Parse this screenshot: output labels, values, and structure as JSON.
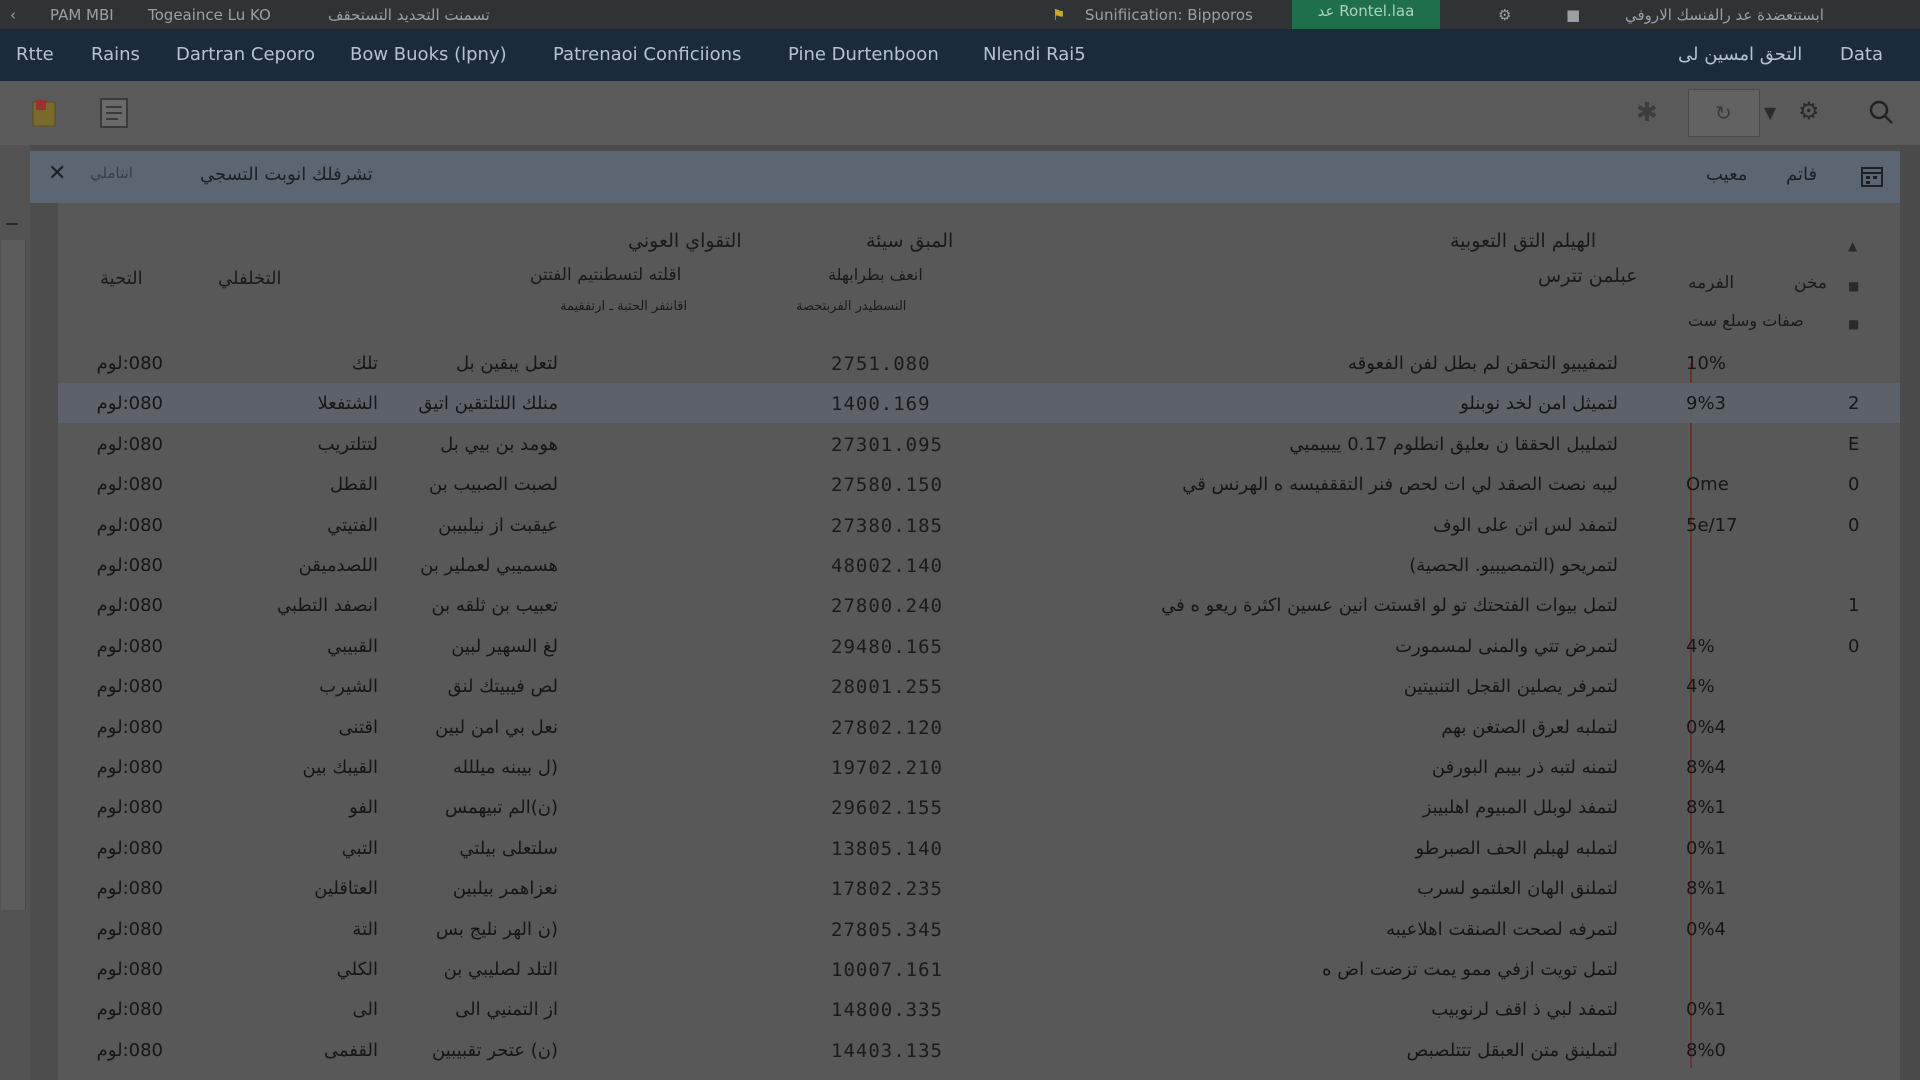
{
  "topbar": {
    "back_label": "PAM MBI",
    "tab1": "Togeaince Lu KO",
    "tab2": "تسمنت التحديد التستحقف",
    "notification": "Sunifiication: Bipporos",
    "active_button": "عد Rontel.laa",
    "right_text": "ابستتعضدة عد رالفنسك الاروفي"
  },
  "menu": {
    "items": [
      "Rtte",
      "Rains",
      "Dartran Ceporo",
      "Bow Buoks (lpny)",
      "Patrenaoi Conficiions",
      "Pine Durtenboon",
      "Nlendi Rai5"
    ],
    "right_item": "التحق امسين لى",
    "brand": "Data"
  },
  "banner": {
    "title": "تشرفلك انوبت التسجي",
    "subtitle": "انتاملي",
    "right1": "فاتم",
    "right2": "معيب"
  },
  "table": {
    "headers": {
      "col_total": "التحية",
      "col_name": "التخلفلي",
      "col_desc_line1": "التقواي العوني",
      "col_desc_line2": "اقلته لتسطنتيم الفتتن",
      "col_desc_line3": "اقانتفر الحتبة ـ ارتفقيمة",
      "col_amount_line1": "المبق سيئة",
      "col_amount_line2": "انعف بطرابهلة",
      "col_amount_line3": "النسطيدر الفربتحصة",
      "col_title_line1": "الهيلم التق التعوبية",
      "col_title_line2": "عبلمن تترس",
      "col_code": "الفرمه",
      "col_type": "مخن",
      "col_sub": "صفات وسلع ست"
    },
    "rows": [
      {
        "total": "080:لوم",
        "name": "تلك",
        "person": "لتعل يبقين بل",
        "amount": "2751.080",
        "desc": "لتمفيبيو التحقن لم بطل لفن الفعوقه",
        "code": "10%",
        "idx": ""
      },
      {
        "total": "080:لوم",
        "name": "الشتفعلا",
        "person": "منلك اللتلتقين اتيق",
        "amount": "1400.169",
        "desc": "لتميثل امن لخد نوبنلو",
        "code": "9%3",
        "idx": "2"
      },
      {
        "total": "080:لوم",
        "name": "لتتلتريب",
        "person": "هومد بن بيي بل",
        "amount": "27301.095",
        "desc": "لتمليبل الحققا ن ىعليق انطلوم 0.17 ييبيميي",
        "code": "",
        "idx": "E"
      },
      {
        "total": "080:لوم",
        "name": "القطل",
        "person": "لصبت الصبيب بن",
        "amount": "27580.150",
        "desc": "ليبه نصت الصقد لي ات لحص فنر التققفيسه ه الهرنس قي",
        "code": "Ome",
        "idx": "0"
      },
      {
        "total": "080:لوم",
        "name": "الفتيتي",
        "person": "عيقبت از نيلبيبن",
        "amount": "27380.185",
        "desc": "لتمفد لس اتن على الوف",
        "code": "5e/17",
        "idx": "0"
      },
      {
        "total": "080:لوم",
        "name": "اللصدميقن",
        "person": "هسميبي لعملير بن",
        "amount": "48002.140",
        "desc": "لتمريحو (التمصيبيو. الحصية)",
        "code": "",
        "idx": ""
      },
      {
        "total": "080:لوم",
        "name": "انصفد التطبي",
        "person": "تعبيب بن ثلقه بن",
        "amount": "27800.240",
        "desc": "لتمل بيوات الفتحتك تو لو اقستت انين عسين اكثرة ريعو ه في",
        "code": "",
        "idx": "1"
      },
      {
        "total": "080:لوم",
        "name": "القبيبي",
        "person": "لغ السهير لبين",
        "amount": "29480.165",
        "desc": "لتمرض تتي والمنى لمسمورت",
        "code": "4%",
        "idx": "0"
      },
      {
        "total": "080:لوم",
        "name": "الشيرب",
        "person": "لص فيبيتك لنق",
        "amount": "28001.255",
        "desc": "لتمرفر يصلين القجل التنبيتين",
        "code": "4%",
        "idx": ""
      },
      {
        "total": "080:لوم",
        "name": "اقتنى",
        "person": "نعل بي امن لبين",
        "amount": "27802.120",
        "desc": "لتملبه لعرق الصتغن بهم",
        "code": "0%4",
        "idx": ""
      },
      {
        "total": "080:لوم",
        "name": "القيبك بين",
        "person": "(ل بيبنه ميللله",
        "amount": "19702.210",
        "desc": "لتمنه لتبه ذر بيبم البورفن",
        "code": "8%4",
        "idx": ""
      },
      {
        "total": "080:لوم",
        "name": "الفو",
        "person": "(ن)الم تبيهمس",
        "amount": "29602.155",
        "desc": "لتمفد لوبلل المبيوم اهلبيبز",
        "code": "8%1",
        "idx": ""
      },
      {
        "total": "080:لوم",
        "name": "التبي",
        "person": "سلتعلى بيلتي",
        "amount": "13805.140",
        "desc": "لتملبه لهبلم الحف الصبرطو",
        "code": "0%1",
        "idx": ""
      },
      {
        "total": "080:لوم",
        "name": "العتاقلين",
        "person": "نعزاهمر بيلبين",
        "amount": "17802.235",
        "desc": "لتملنق الهان العلتمو لسرب",
        "code": "8%1",
        "idx": ""
      },
      {
        "total": "080:لوم",
        "name": "التة",
        "person": "(ن الهر نليج بس",
        "amount": "27805.345",
        "desc": "لتمرفه لصحت الصنقت اهلاعيبه",
        "code": "0%4",
        "idx": ""
      },
      {
        "total": "080:لوم",
        "name": "الكلي",
        "person": "التلد لصليبي بن",
        "amount": "10007.161",
        "desc": "لتمل تويت ازفي ممو يمت تزضت اض ه",
        "code": "",
        "idx": ""
      },
      {
        "total": "080:لوم",
        "name": "الى",
        "person": "از التمنيي الى",
        "amount": "14800.335",
        "desc": "لتمفد لبي ذ اقف لرنوبيب",
        "code": "0%1",
        "idx": ""
      },
      {
        "total": "080:لوم",
        "name": "القفمى",
        "person": "(ن) عتحر تقبيبين",
        "amount": "14403.135",
        "desc": "لتملينق متن العبقل تتتلصبص",
        "code": "8%0",
        "idx": ""
      }
    ]
  },
  "colors": {
    "accent_green": "#1f6f4a",
    "menu_bg": "#1c2b3c",
    "divider_red": "#6b3232"
  }
}
